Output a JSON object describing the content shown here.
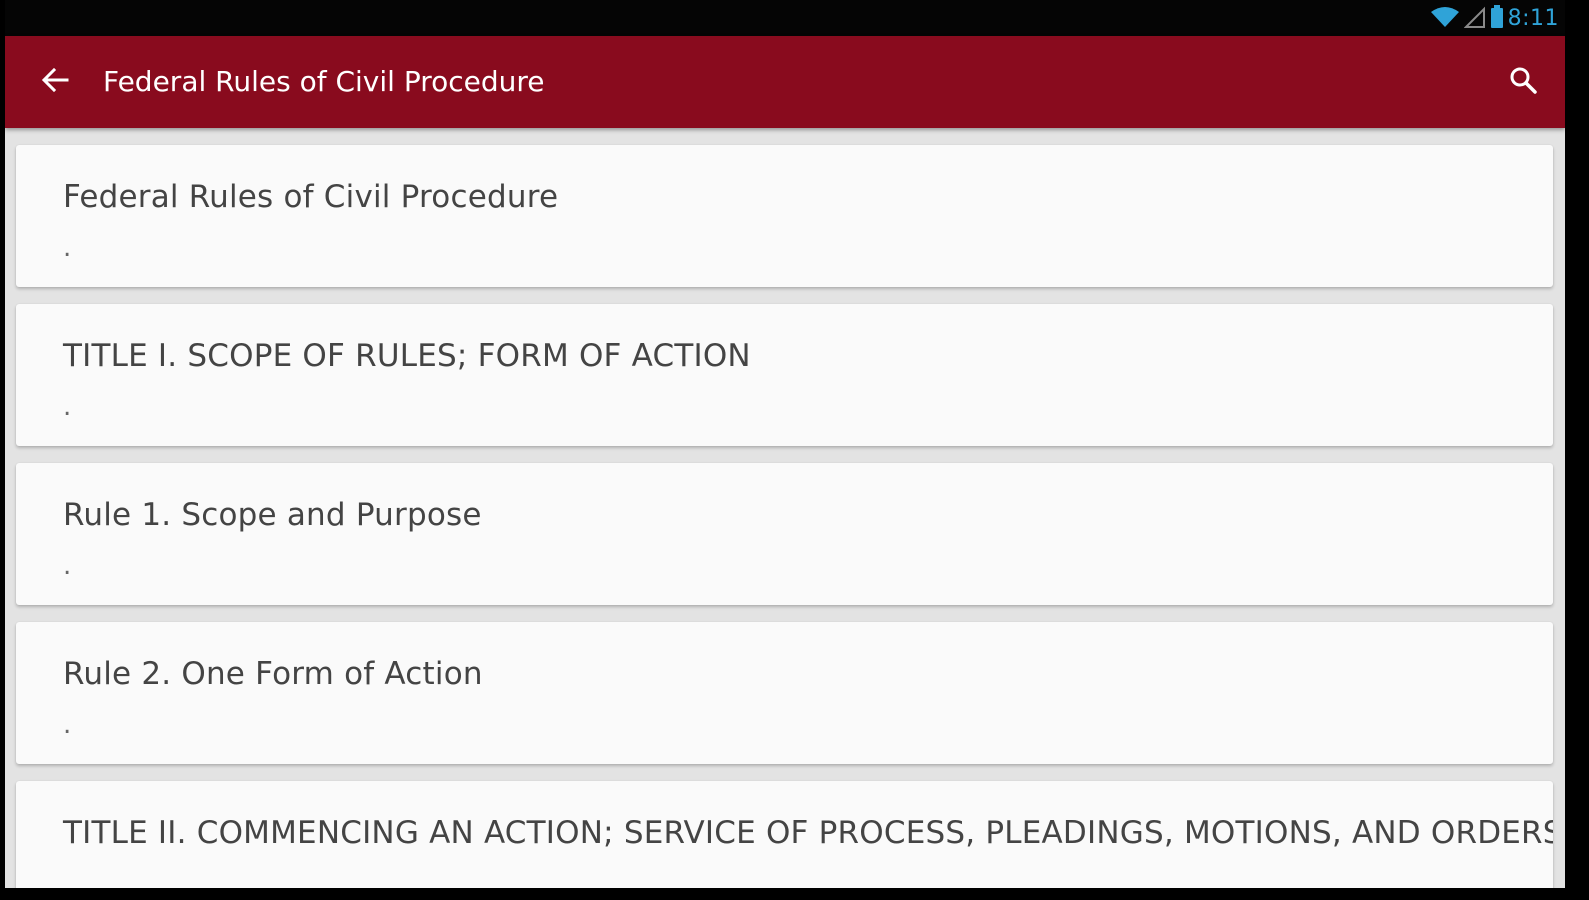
{
  "status_bar": {
    "time": "8:11",
    "icons": [
      "wifi-icon",
      "signal-icon",
      "battery-icon"
    ]
  },
  "app_bar": {
    "title": "Federal Rules of Civil Procedure",
    "back_icon": "arrow-back-icon",
    "search_icon": "search-icon",
    "background_color": "#890b1e"
  },
  "list": {
    "items": [
      {
        "title": "Federal Rules of Civil Procedure",
        "subtitle": "."
      },
      {
        "title": "TITLE I. SCOPE OF RULES; FORM OF ACTION",
        "subtitle": "."
      },
      {
        "title": "Rule 1. Scope and Purpose",
        "subtitle": "."
      },
      {
        "title": "Rule 2. One Form of Action",
        "subtitle": "."
      },
      {
        "title": "TITLE II. COMMENCING AN ACTION; SERVICE OF PROCESS, PLEADINGS, MOTIONS, AND ORDERS",
        "subtitle": ""
      }
    ]
  }
}
